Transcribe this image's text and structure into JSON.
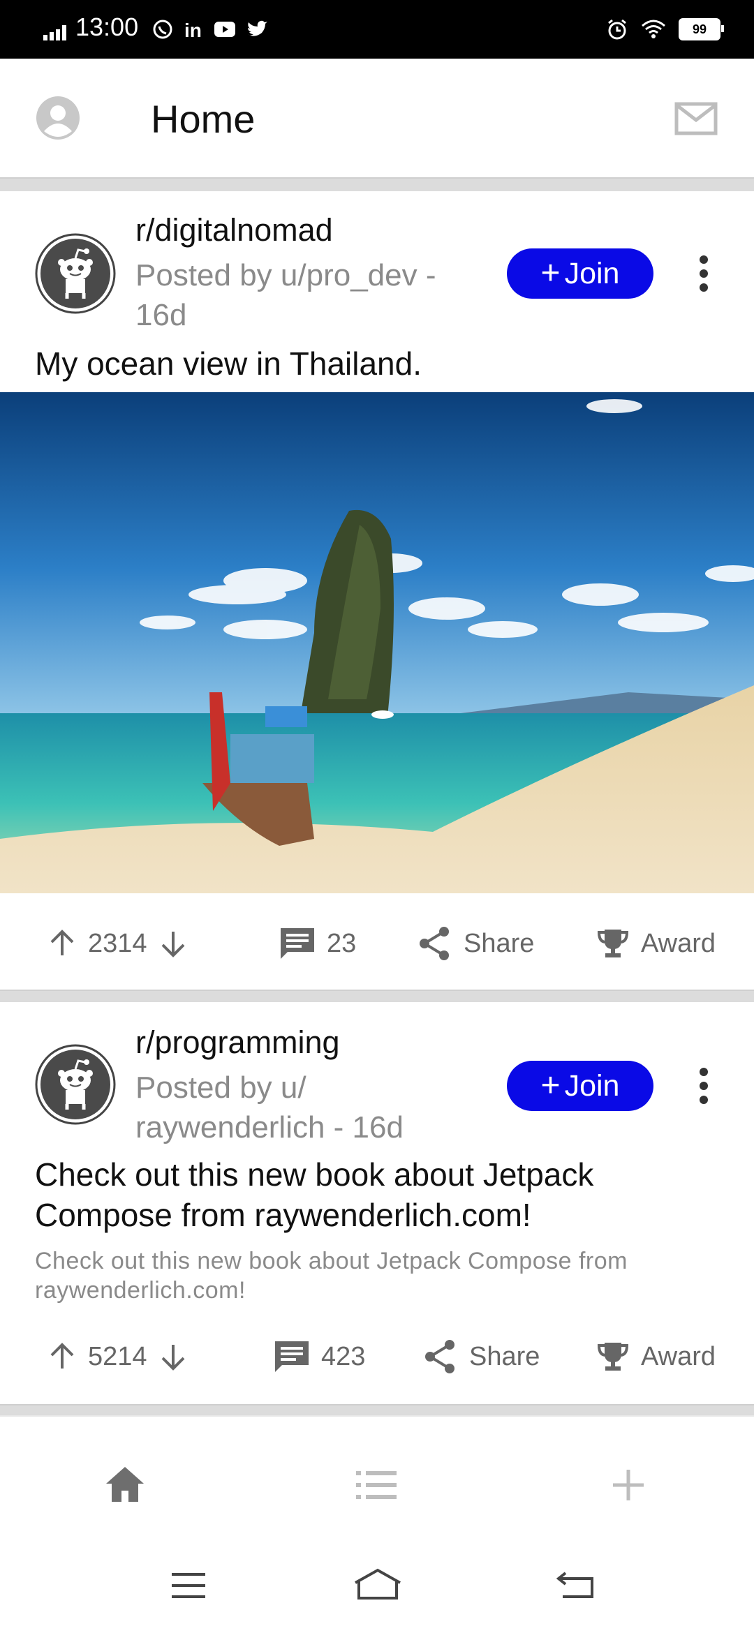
{
  "status_bar": {
    "time": "13:00",
    "battery": "99",
    "left_icons": [
      "signal-icon",
      "whatsapp-icon",
      "linkedin-icon",
      "youtube-icon",
      "twitter-icon"
    ],
    "right_icons": [
      "alarm-icon",
      "wifi-icon",
      "battery-icon"
    ]
  },
  "top_bar": {
    "title": "Home",
    "left_icon": "account-circle-icon",
    "right_icon": "mail-icon"
  },
  "posts": [
    {
      "subreddit": "r/digitalnomad",
      "meta_line1": "Posted by u/pro_dev -",
      "meta_line2": "16d",
      "join_label": "Join",
      "title": "My ocean view in Thailand.",
      "votes": "2314",
      "comments": "23",
      "share_label": "Share",
      "award_label": "Award"
    },
    {
      "subreddit": "r/programming",
      "meta_line1": "Posted by u/",
      "meta_line2": "raywenderlich - 16d",
      "join_label": "Join",
      "title_line1": "Check out this new book about Jetpack",
      "title_line2": "Compose from raywenderlich.com!",
      "body_line1": "Check out this new book about Jetpack Compose from",
      "body_line2": "raywenderlich.com!",
      "votes": "5214",
      "comments": "423",
      "share_label": "Share",
      "award_label": "Award"
    }
  ],
  "bottom_nav": {
    "items": [
      "home-icon",
      "list-icon",
      "add-icon"
    ],
    "active_color": "#6e6e6e",
    "inactive_color": "#bdbdbd"
  },
  "system_nav": [
    "menu-icon",
    "home-outline-icon",
    "back-icon"
  ],
  "colors": {
    "join_button": "#0a0ae6",
    "divider": "#dcdcdc"
  }
}
